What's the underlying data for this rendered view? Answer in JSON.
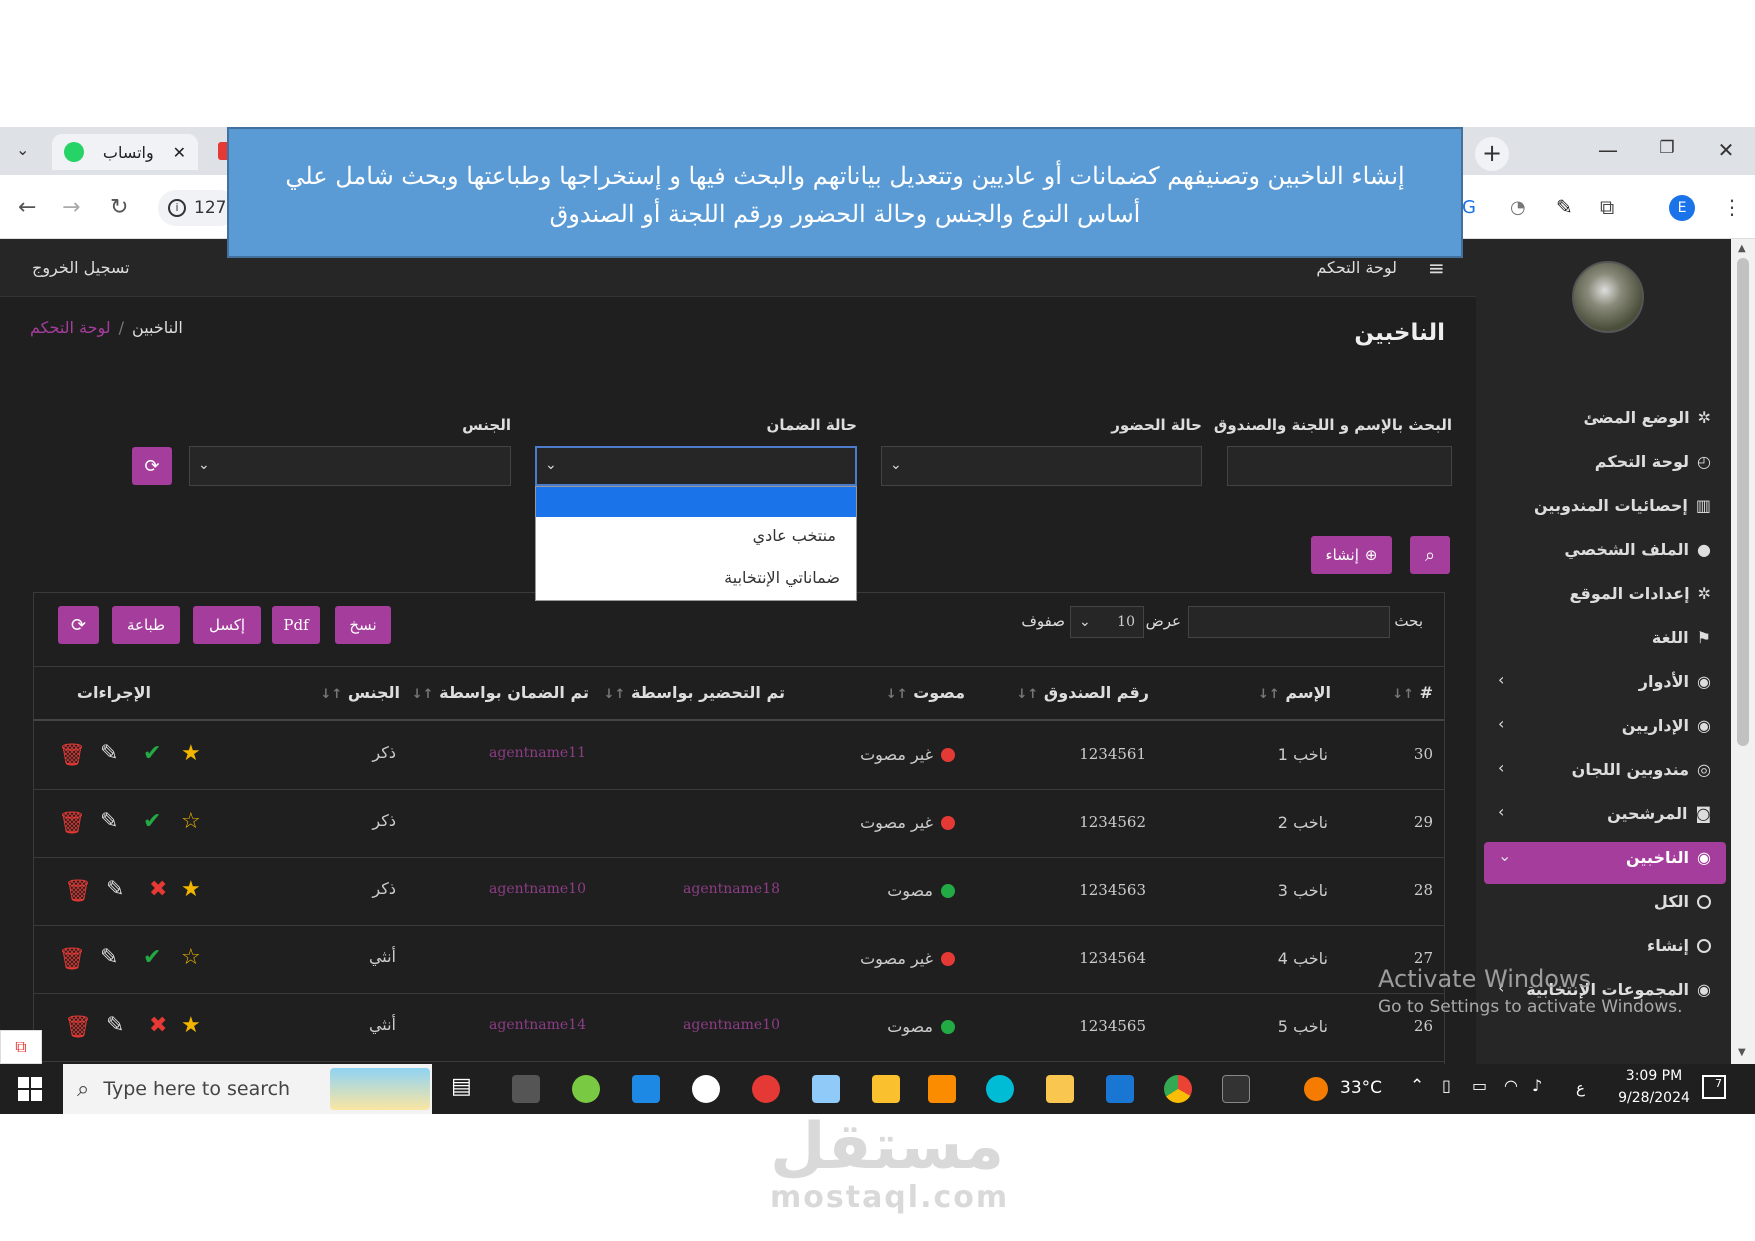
{
  "browser": {
    "tab_title": "واتساب",
    "tab_close": "✕",
    "new_tab": "+",
    "tab_menu": "⌄",
    "url_partial": "127",
    "profile_letter": "E"
  },
  "banner": {
    "line1": "إنشاء الناخبين وتصنيفهم كضمانات أو عاديين وتتعديل بياناتهم والبحث فيها و إستخراجها وطباعتها وبحث شامل علي",
    "line2": "أساس النوع والجنس وحالة الحضور ورقم اللجنة أو الصندوق"
  },
  "topbar": {
    "dashboard": "لوحة التحكم",
    "logout": "تسجيل الخروج"
  },
  "page": {
    "title": "الناخبين",
    "breadcrumb_home": "لوحة التحكم",
    "breadcrumb_sep": "/",
    "breadcrumb_current": "الناخبين"
  },
  "sidebar": {
    "items": [
      {
        "label": "الوضع المضئ",
        "icon": "gear-icon"
      },
      {
        "label": "لوحة التحكم",
        "icon": "dashboard-icon"
      },
      {
        "label": "إحصائيات المندوبين",
        "icon": "chart-icon"
      },
      {
        "label": "الملف الشخصي",
        "icon": "user-icon"
      },
      {
        "label": "إعدادات الموقع",
        "icon": "cogs-icon"
      },
      {
        "label": "اللغة",
        "icon": "flag-icon"
      },
      {
        "label": "الأدوار",
        "icon": "users-cog-icon"
      },
      {
        "label": "الإداريين",
        "icon": "user-tie-icon"
      },
      {
        "label": "مندوبين اللجان",
        "icon": "user-circle-icon"
      },
      {
        "label": "المرشحين",
        "icon": "user-badge-icon"
      },
      {
        "label": "الناخبين",
        "icon": "user-plus-icon"
      },
      {
        "label": "الكل",
        "icon": "radio-icon"
      },
      {
        "label": "إنشاء",
        "icon": "radio-icon"
      },
      {
        "label": "المجموعات الإنتخابية",
        "icon": "users-icon"
      }
    ]
  },
  "filters": {
    "search_label": "البحث بالإسم و اللجنة والصندوق",
    "attendance_label": "حالة الحضور",
    "guarantee_label": "حالة الضمان",
    "gender_label": "الجنس",
    "dropdown_options": [
      "",
      "منتخب عادي",
      "ضماناتي الإنتخابية"
    ]
  },
  "buttons": {
    "create": "إنشاء",
    "copy": "نسخ",
    "pdf": "Pdf",
    "excel": "إكسل",
    "print": "طباعة"
  },
  "table_controls": {
    "search_label": "بحث",
    "show_label": "عرض",
    "page_size": "10",
    "rows_label": "صفوف"
  },
  "table": {
    "headers": [
      "#",
      "الإسم",
      "رقم الصندوق",
      "مصوت",
      "تم التحضير بواسطة",
      "تم الضمان بواسطة",
      "الجنس",
      "الإجراءات"
    ],
    "rows": [
      {
        "id": "30",
        "name": "ناخب 1",
        "box": "1234561",
        "status": "غير مصوت",
        "voted": false,
        "prepared_by": "",
        "guaranteed_by": "agentname11",
        "gender": "ذكر",
        "starred": true,
        "confirmed": true
      },
      {
        "id": "29",
        "name": "ناخب 2",
        "box": "1234562",
        "status": "غير مصوت",
        "voted": false,
        "prepared_by": "",
        "guaranteed_by": "",
        "gender": "ذكر",
        "starred": false,
        "confirmed": true
      },
      {
        "id": "28",
        "name": "ناخب 3",
        "box": "1234563",
        "status": "مصوت",
        "voted": true,
        "prepared_by": "agentname18",
        "guaranteed_by": "agentname10",
        "gender": "ذكر",
        "starred": true,
        "confirmed": false
      },
      {
        "id": "27",
        "name": "ناخب 4",
        "box": "1234564",
        "status": "غير مصوت",
        "voted": false,
        "prepared_by": "",
        "guaranteed_by": "",
        "gender": "أنثي",
        "starred": false,
        "confirmed": true
      },
      {
        "id": "26",
        "name": "ناخب 5",
        "box": "1234565",
        "status": "مصوت",
        "voted": true,
        "prepared_by": "agentname10",
        "guaranteed_by": "agentname14",
        "gender": "أنثي",
        "starred": true,
        "confirmed": false
      }
    ]
  },
  "watermark": {
    "line1": "Activate Windows",
    "line2": "Go to Settings to activate Windows."
  },
  "taskbar": {
    "search_placeholder": "Type here to search",
    "weather": "33°C",
    "lang": "ع",
    "time": "3:09 PM",
    "date": "9/28/2024",
    "notif_count": "7"
  },
  "logo": {
    "arabic": "مستقل",
    "latin": "mostaql.com"
  },
  "colors": {
    "accent": "#a43d9b",
    "banner": "#5b9bd5",
    "bg_dark": "#1f1f1f",
    "voted": "#22aa44",
    "not_voted": "#e53935",
    "star": "#f2b600"
  }
}
